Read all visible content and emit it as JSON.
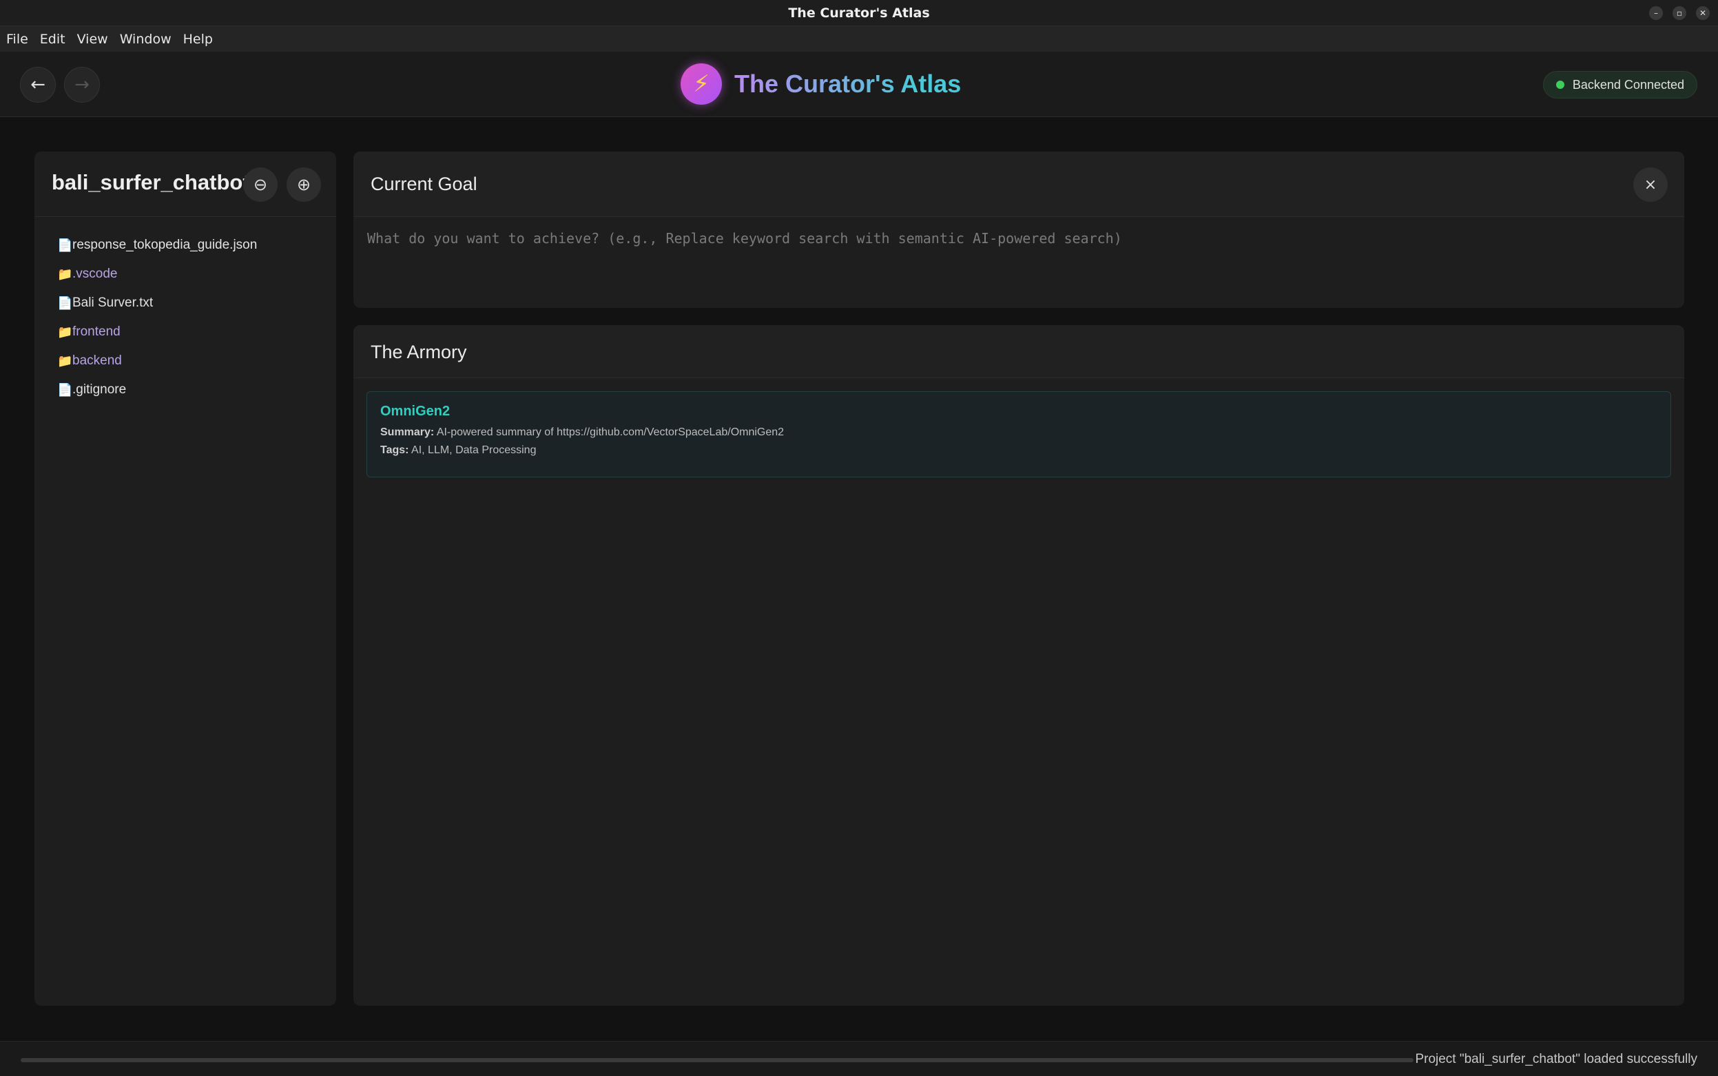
{
  "window": {
    "title": "The Curator's Atlas",
    "controls": [
      "minimize",
      "maximize",
      "close"
    ]
  },
  "menu": [
    "File",
    "Edit",
    "View",
    "Window",
    "Help"
  ],
  "header": {
    "back_icon": "←",
    "forward_icon": "→",
    "logo_icon": "⚡",
    "app_title": "The Curator's Atlas",
    "status": "Backend Connected",
    "status_color": "#3ecf5a"
  },
  "sidebar": {
    "project_name": "bali_surfer_chatbot",
    "collapse_icon": "⊖",
    "expand_icon": "⊕",
    "items": [
      {
        "type": "file",
        "icon": "📄",
        "label": "response_tokopedia_guide.json"
      },
      {
        "type": "folder",
        "icon": "📁",
        "label": ".vscode"
      },
      {
        "type": "file",
        "icon": "📄",
        "label": "Bali Surver.txt"
      },
      {
        "type": "folder",
        "icon": "📁",
        "label": "frontend"
      },
      {
        "type": "folder",
        "icon": "📁",
        "label": "backend"
      },
      {
        "type": "file",
        "icon": "📄",
        "label": ".gitignore"
      }
    ]
  },
  "goal": {
    "title": "Current Goal",
    "close_icon": "×",
    "value": "",
    "placeholder": "What do you want to achieve? (e.g., Replace keyword search with semantic AI-powered search)"
  },
  "armory": {
    "title": "The Armory",
    "tools": [
      {
        "name": "OmniGen2",
        "summary_label": "Summary:",
        "summary": "AI-powered summary of https://github.com/VectorSpaceLab/OmniGen2",
        "tags_label": "Tags:",
        "tags": "AI, LLM, Data Processing"
      }
    ]
  },
  "footer": {
    "message": "Project \"bali_surfer_chatbot\" loaded successfully"
  }
}
